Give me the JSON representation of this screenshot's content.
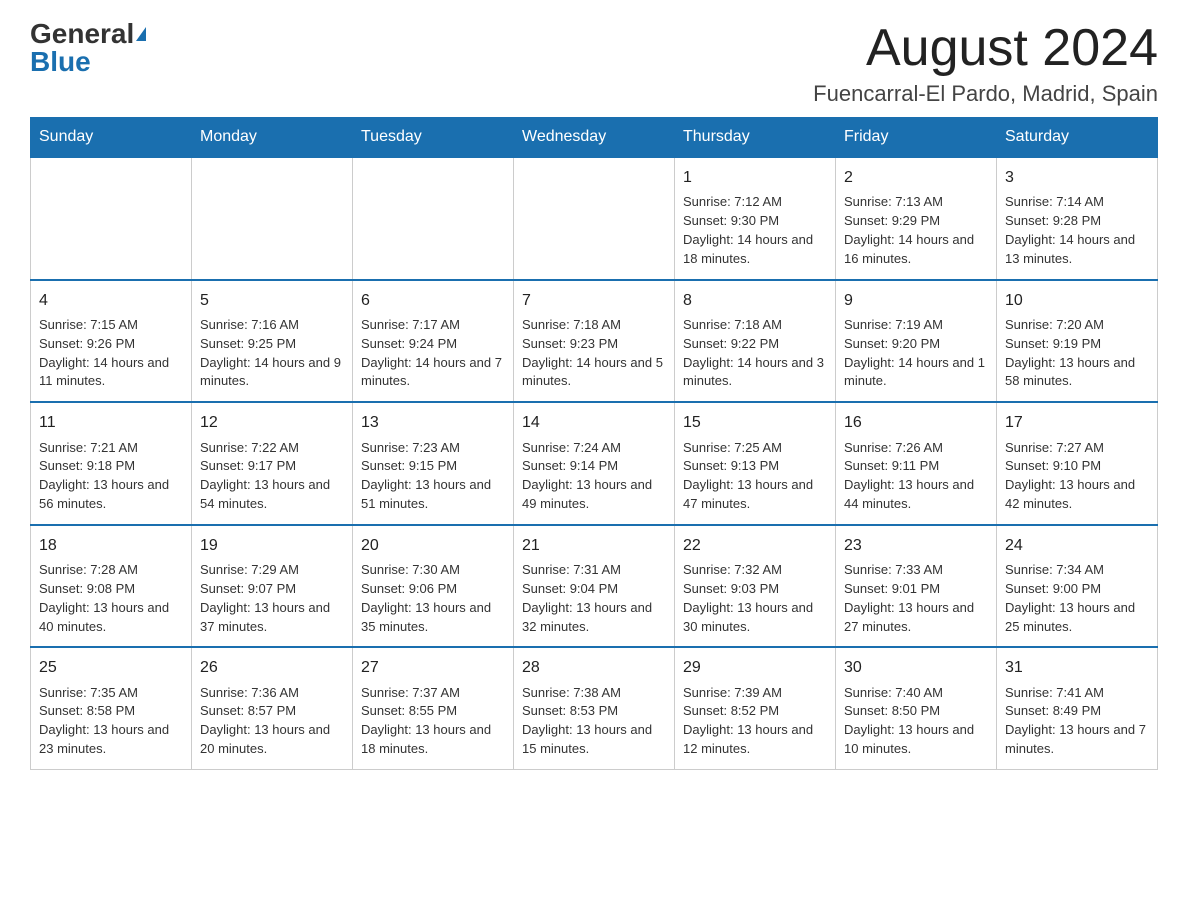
{
  "header": {
    "logo_general": "General",
    "logo_blue": "Blue",
    "month_title": "August 2024",
    "location": "Fuencarral-El Pardo, Madrid, Spain"
  },
  "days_of_week": [
    "Sunday",
    "Monday",
    "Tuesday",
    "Wednesday",
    "Thursday",
    "Friday",
    "Saturday"
  ],
  "weeks": [
    {
      "days": [
        {
          "number": "",
          "info": ""
        },
        {
          "number": "",
          "info": ""
        },
        {
          "number": "",
          "info": ""
        },
        {
          "number": "",
          "info": ""
        },
        {
          "number": "1",
          "info": "Sunrise: 7:12 AM\nSunset: 9:30 PM\nDaylight: 14 hours and 18 minutes."
        },
        {
          "number": "2",
          "info": "Sunrise: 7:13 AM\nSunset: 9:29 PM\nDaylight: 14 hours and 16 minutes."
        },
        {
          "number": "3",
          "info": "Sunrise: 7:14 AM\nSunset: 9:28 PM\nDaylight: 14 hours and 13 minutes."
        }
      ]
    },
    {
      "days": [
        {
          "number": "4",
          "info": "Sunrise: 7:15 AM\nSunset: 9:26 PM\nDaylight: 14 hours and 11 minutes."
        },
        {
          "number": "5",
          "info": "Sunrise: 7:16 AM\nSunset: 9:25 PM\nDaylight: 14 hours and 9 minutes."
        },
        {
          "number": "6",
          "info": "Sunrise: 7:17 AM\nSunset: 9:24 PM\nDaylight: 14 hours and 7 minutes."
        },
        {
          "number": "7",
          "info": "Sunrise: 7:18 AM\nSunset: 9:23 PM\nDaylight: 14 hours and 5 minutes."
        },
        {
          "number": "8",
          "info": "Sunrise: 7:18 AM\nSunset: 9:22 PM\nDaylight: 14 hours and 3 minutes."
        },
        {
          "number": "9",
          "info": "Sunrise: 7:19 AM\nSunset: 9:20 PM\nDaylight: 14 hours and 1 minute."
        },
        {
          "number": "10",
          "info": "Sunrise: 7:20 AM\nSunset: 9:19 PM\nDaylight: 13 hours and 58 minutes."
        }
      ]
    },
    {
      "days": [
        {
          "number": "11",
          "info": "Sunrise: 7:21 AM\nSunset: 9:18 PM\nDaylight: 13 hours and 56 minutes."
        },
        {
          "number": "12",
          "info": "Sunrise: 7:22 AM\nSunset: 9:17 PM\nDaylight: 13 hours and 54 minutes."
        },
        {
          "number": "13",
          "info": "Sunrise: 7:23 AM\nSunset: 9:15 PM\nDaylight: 13 hours and 51 minutes."
        },
        {
          "number": "14",
          "info": "Sunrise: 7:24 AM\nSunset: 9:14 PM\nDaylight: 13 hours and 49 minutes."
        },
        {
          "number": "15",
          "info": "Sunrise: 7:25 AM\nSunset: 9:13 PM\nDaylight: 13 hours and 47 minutes."
        },
        {
          "number": "16",
          "info": "Sunrise: 7:26 AM\nSunset: 9:11 PM\nDaylight: 13 hours and 44 minutes."
        },
        {
          "number": "17",
          "info": "Sunrise: 7:27 AM\nSunset: 9:10 PM\nDaylight: 13 hours and 42 minutes."
        }
      ]
    },
    {
      "days": [
        {
          "number": "18",
          "info": "Sunrise: 7:28 AM\nSunset: 9:08 PM\nDaylight: 13 hours and 40 minutes."
        },
        {
          "number": "19",
          "info": "Sunrise: 7:29 AM\nSunset: 9:07 PM\nDaylight: 13 hours and 37 minutes."
        },
        {
          "number": "20",
          "info": "Sunrise: 7:30 AM\nSunset: 9:06 PM\nDaylight: 13 hours and 35 minutes."
        },
        {
          "number": "21",
          "info": "Sunrise: 7:31 AM\nSunset: 9:04 PM\nDaylight: 13 hours and 32 minutes."
        },
        {
          "number": "22",
          "info": "Sunrise: 7:32 AM\nSunset: 9:03 PM\nDaylight: 13 hours and 30 minutes."
        },
        {
          "number": "23",
          "info": "Sunrise: 7:33 AM\nSunset: 9:01 PM\nDaylight: 13 hours and 27 minutes."
        },
        {
          "number": "24",
          "info": "Sunrise: 7:34 AM\nSunset: 9:00 PM\nDaylight: 13 hours and 25 minutes."
        }
      ]
    },
    {
      "days": [
        {
          "number": "25",
          "info": "Sunrise: 7:35 AM\nSunset: 8:58 PM\nDaylight: 13 hours and 23 minutes."
        },
        {
          "number": "26",
          "info": "Sunrise: 7:36 AM\nSunset: 8:57 PM\nDaylight: 13 hours and 20 minutes."
        },
        {
          "number": "27",
          "info": "Sunrise: 7:37 AM\nSunset: 8:55 PM\nDaylight: 13 hours and 18 minutes."
        },
        {
          "number": "28",
          "info": "Sunrise: 7:38 AM\nSunset: 8:53 PM\nDaylight: 13 hours and 15 minutes."
        },
        {
          "number": "29",
          "info": "Sunrise: 7:39 AM\nSunset: 8:52 PM\nDaylight: 13 hours and 12 minutes."
        },
        {
          "number": "30",
          "info": "Sunrise: 7:40 AM\nSunset: 8:50 PM\nDaylight: 13 hours and 10 minutes."
        },
        {
          "number": "31",
          "info": "Sunrise: 7:41 AM\nSunset: 8:49 PM\nDaylight: 13 hours and 7 minutes."
        }
      ]
    }
  ]
}
